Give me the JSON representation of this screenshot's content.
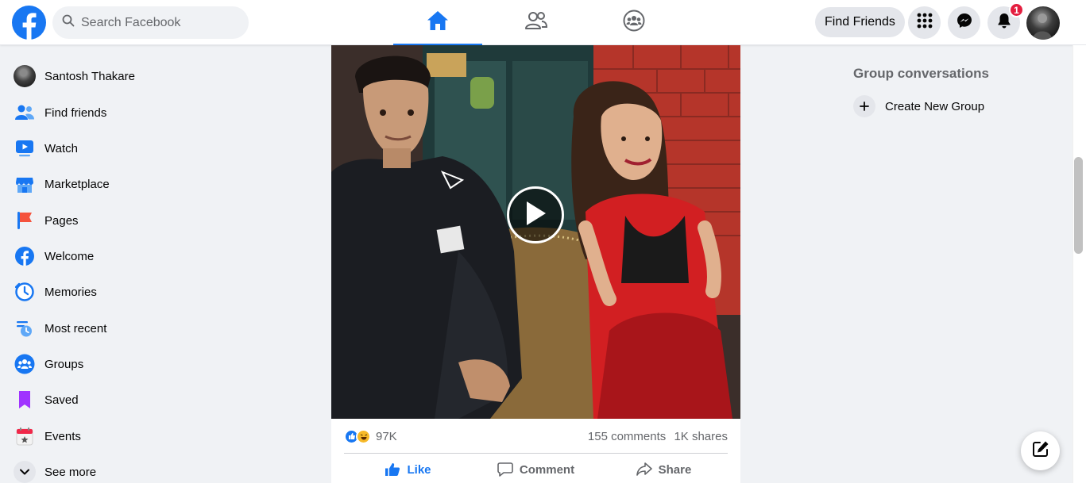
{
  "colors": {
    "brand": "#1877f2",
    "badge": "#e41e3f",
    "secondary_text": "#65676b"
  },
  "header": {
    "search_placeholder": "Search Facebook",
    "find_friends_label": "Find Friends",
    "notification_count": "1",
    "nav_tabs": [
      {
        "icon": "home-icon",
        "active": true
      },
      {
        "icon": "friends-icon",
        "active": false
      },
      {
        "icon": "groups-icon",
        "active": false
      }
    ]
  },
  "sidebar": {
    "items": [
      {
        "label": "Santosh Thakare",
        "icon": "profile-avatar"
      },
      {
        "label": "Find friends",
        "icon": "find-friends-icon"
      },
      {
        "label": "Watch",
        "icon": "watch-icon"
      },
      {
        "label": "Marketplace",
        "icon": "marketplace-icon"
      },
      {
        "label": "Pages",
        "icon": "pages-flag-icon"
      },
      {
        "label": "Welcome",
        "icon": "facebook-welcome-icon"
      },
      {
        "label": "Memories",
        "icon": "memories-clock-icon"
      },
      {
        "label": "Most recent",
        "icon": "most-recent-icon"
      },
      {
        "label": "Groups",
        "icon": "groups-icon"
      },
      {
        "label": "Saved",
        "icon": "saved-bookmark-icon"
      },
      {
        "label": "Events",
        "icon": "events-calendar-icon"
      },
      {
        "label": "See more",
        "icon": "chevron-down-icon"
      }
    ]
  },
  "post": {
    "reaction_count": "97K",
    "comments": "155 comments",
    "shares": "1K shares",
    "actions": {
      "like": "Like",
      "comment": "Comment",
      "share": "Share"
    }
  },
  "right": {
    "group_conversations_title": "Group conversations",
    "create_group_label": "Create New Group"
  }
}
